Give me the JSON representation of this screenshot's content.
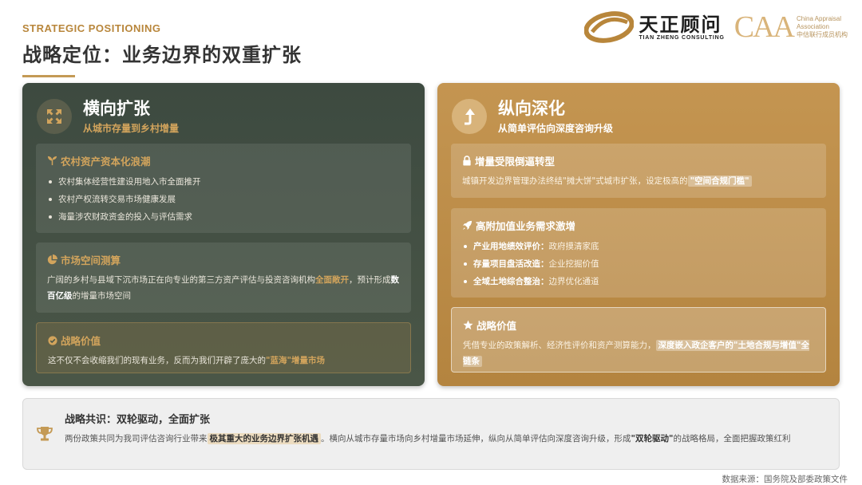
{
  "header": {
    "eyebrow": "STRATEGIC POSITIONING",
    "title": "战略定位：业务边界的双重扩张"
  },
  "logos": {
    "tianzheng_cn": "天正顾问",
    "tianzheng_en": "TIAN ZHENG CONSULTING",
    "caa_mark": "CAA",
    "caa_en_1": "China Appraisal",
    "caa_en_2": "Association",
    "caa_cn": "中估联行成员机构"
  },
  "colors": {
    "accent_gold": "#c49a55",
    "left_card": "#3d4a40",
    "right_card": "#c49551"
  },
  "left": {
    "icon": "expand-arrows-icon",
    "title": "横向扩张",
    "subtitle": "从城市存量到乡村增量",
    "box1": {
      "icon": "sprout-icon",
      "title": "农村资产资本化浪潮",
      "items": [
        "农村集体经营性建设用地入市全面推开",
        "农村产权流转交易市场健康发展",
        "海量涉农财政资金的投入与评估需求"
      ]
    },
    "box2": {
      "icon": "pie-chart-icon",
      "title": "市场空间测算",
      "text_1": "广阔的乡村与县域下沉市场正在向专业的第三方资产评估与投资咨询机构",
      "hl_1": "全面敞开",
      "text_2": "，预计形成",
      "hl_2": "数百亿级",
      "text_3": "的增量市场空间"
    },
    "box3": {
      "icon": "check-circle-icon",
      "title": "战略价值",
      "text_1": "这不仅不会收缩我们的现有业务，反而为我们开辟了庞大的",
      "hl_1": "\"蓝海\"增量市场"
    }
  },
  "right": {
    "icon": "level-up-arrow-icon",
    "title": "纵向深化",
    "subtitle": "从简单评估向深度咨询升级",
    "box1": {
      "icon": "lock-icon",
      "title": "增量受限倒逼转型",
      "text_1": "城镇开发边界管理办法终结\"摊大饼\"式城市扩张，设定极高的",
      "hl_1": "\"空间合规门槛\""
    },
    "box2": {
      "icon": "rocket-icon",
      "title": "高附加值业务需求激增",
      "items": [
        {
          "term": "产业用地绩效评价：",
          "desc": "政府摸清家底"
        },
        {
          "term": "存量项目盘活改造：",
          "desc": "企业挖掘价值"
        },
        {
          "term": "全域土地综合整治：",
          "desc": "边界优化通道"
        }
      ]
    },
    "box3": {
      "icon": "star-icon",
      "title": "战略价值",
      "text_1": "凭借专业的政策解析、经济性评价和资产测算能力，",
      "hl_1": "深度嵌入政企客户的\"土地合规与增值\"全链条"
    }
  },
  "consensus": {
    "icon": "trophy-icon",
    "title": "战略共识：双轮驱动，全面扩张",
    "text_1": "两份政策共同为我司评估咨询行业带来",
    "hl_1": "极其重大的业务边界扩张机遇",
    "text_2": "。横向从城市存量市场向乡村增量市场延伸，纵向从简单评估向深度咨询升级，形成",
    "hl_2": "\"双轮驱动\"",
    "text_3": "的战略格局，全面把握政策红利"
  },
  "source": "数据来源：国务院及部委政策文件"
}
